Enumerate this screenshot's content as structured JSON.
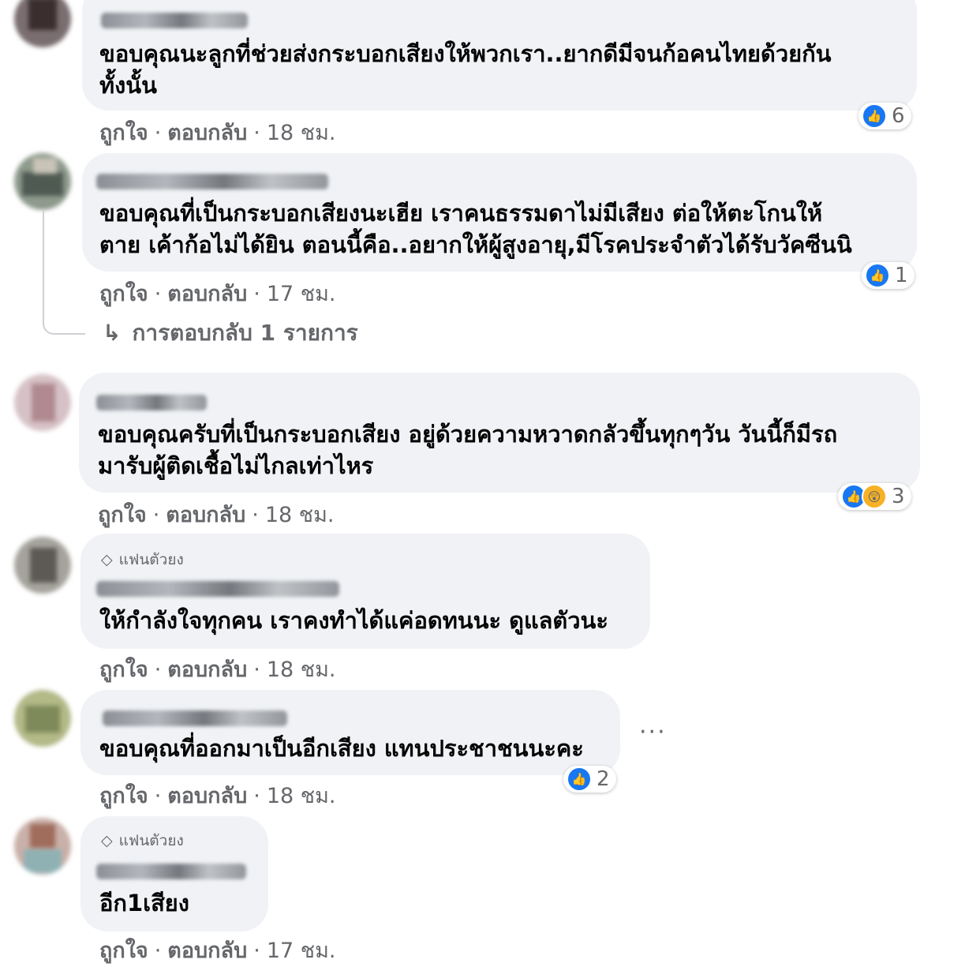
{
  "meta_labels": {
    "like": "ถูกใจ",
    "reply": "ตอบกลับ",
    "separator": "·"
  },
  "comments": [
    {
      "lines": [
        "ขอบคุณนะลูกที่ช่วยส่งกระบอกเสียงให้พวกเรา..ยากดีมีจนก้อคนไทยด้วยกัน",
        "ทั้งนั้น"
      ],
      "time": "18 ชม.",
      "reaction_count": "6",
      "reactions": [
        "like-icon"
      ]
    },
    {
      "lines": [
        "ขอบคุณที่เป็นกระบอกเสียงนะเฮีย เราคนธรรมดาไม่มีเสียง ต่อให้ตะโกนให้",
        "ตาย เค้าก้อไม่ได้ยิน ตอนนี้คือ..อยากให้ผู้สูงอายุ,มีโรคประจำตัวได้รับวัคซีนนิ"
      ],
      "time": "17 ชม.",
      "reaction_count": "1",
      "reactions": [
        "like-icon"
      ],
      "replies_label": "การตอบกลับ 1 รายการ"
    },
    {
      "lines": [
        "ขอบคุณครับที่เป็นกระบอกเสียง อยู่ด้วยความหวาดกลัวขึ้นทุกๆวัน วันนี้ก็มีรถ",
        "มารับผู้ติดเชื้อไม่ไกลเท่าไหร"
      ],
      "time": "18 ชม.",
      "reaction_count": "3",
      "reactions": [
        "like-icon",
        "wow-icon"
      ]
    },
    {
      "badge": "แฟนตัวยง",
      "lines": [
        "ให้กำลังใจทุกคน เราคงทำได้แค่อดทนนะ ดูแลตัวนะ"
      ],
      "time": "18 ชม."
    },
    {
      "lines": [
        "ขอบคุณที่ออกมาเป็นอีกเสียง แทนประชาชนนะคะ"
      ],
      "time": "18 ชม.",
      "reaction_count": "2",
      "reactions": [
        "like-icon"
      ],
      "more_label": "···"
    },
    {
      "badge": "แฟนตัวยง",
      "lines": [
        "อีก1เสียง"
      ],
      "time": "17 ชม."
    }
  ]
}
